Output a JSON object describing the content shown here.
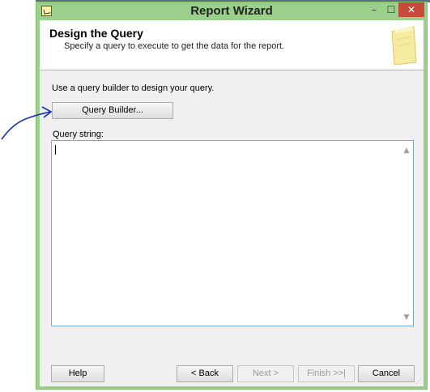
{
  "window": {
    "title": "Report Wizard",
    "minimize_glyph": "–",
    "maximize_glyph": "☐",
    "close_glyph": "✕"
  },
  "header": {
    "title": "Design the Query",
    "subtitle": "Specify a query to execute to get the data for the report.",
    "icon": "wizard-page-icon"
  },
  "query": {
    "instruction": "Use a query builder to design your query.",
    "builder_button": "Query Builder...",
    "string_label": "Query string:",
    "string_value": ""
  },
  "footer": {
    "help": "Help",
    "back": "< Back",
    "next": "Next >",
    "finish": "Finish >>|",
    "cancel": "Cancel"
  },
  "colors": {
    "window_frame": "#9bd08c",
    "close_button": "#c74b3b",
    "annotation_ink": "#1a2fb0"
  }
}
